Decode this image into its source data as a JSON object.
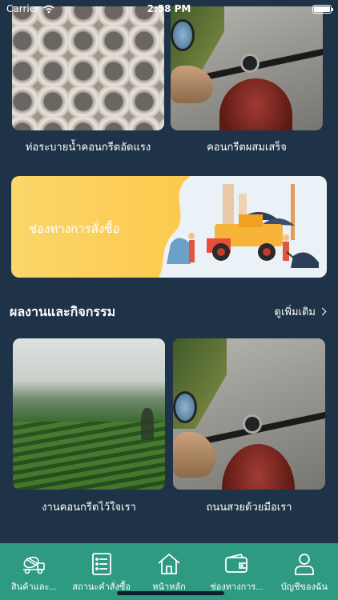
{
  "status_bar": {
    "carrier": "Carrier",
    "time": "2:58 PM",
    "battery_level": 1.0
  },
  "top_products": [
    {
      "caption": "ท่อระบายน้ำคอนกรีตอัดแรง",
      "image": "concrete-pipes"
    },
    {
      "caption": "คอนกรีตผสมเสร็จ",
      "image": "motorcycle-road"
    }
  ],
  "banner": {
    "title": "ช่องทางการสั่งซื้อ"
  },
  "activities": {
    "title": "ผลงานและกิจกรรม",
    "see_more": "ดูเพิ่มเติม",
    "items": [
      {
        "caption": "งานคอนกรีตไว้ใจเรา",
        "image": "tea-plantation"
      },
      {
        "caption": "ถนนสวยด้วยมือเรา",
        "image": "motorcycle-road"
      }
    ]
  },
  "tabbar": {
    "items": [
      {
        "label": "สินค้าและ...",
        "icon": "cement-truck-icon"
      },
      {
        "label": "สถานะคำสั่งซื้อ",
        "icon": "order-list-icon"
      },
      {
        "label": "หน้าหลัก",
        "icon": "home-icon"
      },
      {
        "label": "ช่องทางการ...",
        "icon": "wallet-icon"
      },
      {
        "label": "บัญชีของฉัน",
        "icon": "user-icon"
      }
    ]
  },
  "colors": {
    "background": "#1e3347",
    "tabbar": "#2e9a82",
    "banner_start": "#fbd66a",
    "banner_end": "#f5a623"
  }
}
